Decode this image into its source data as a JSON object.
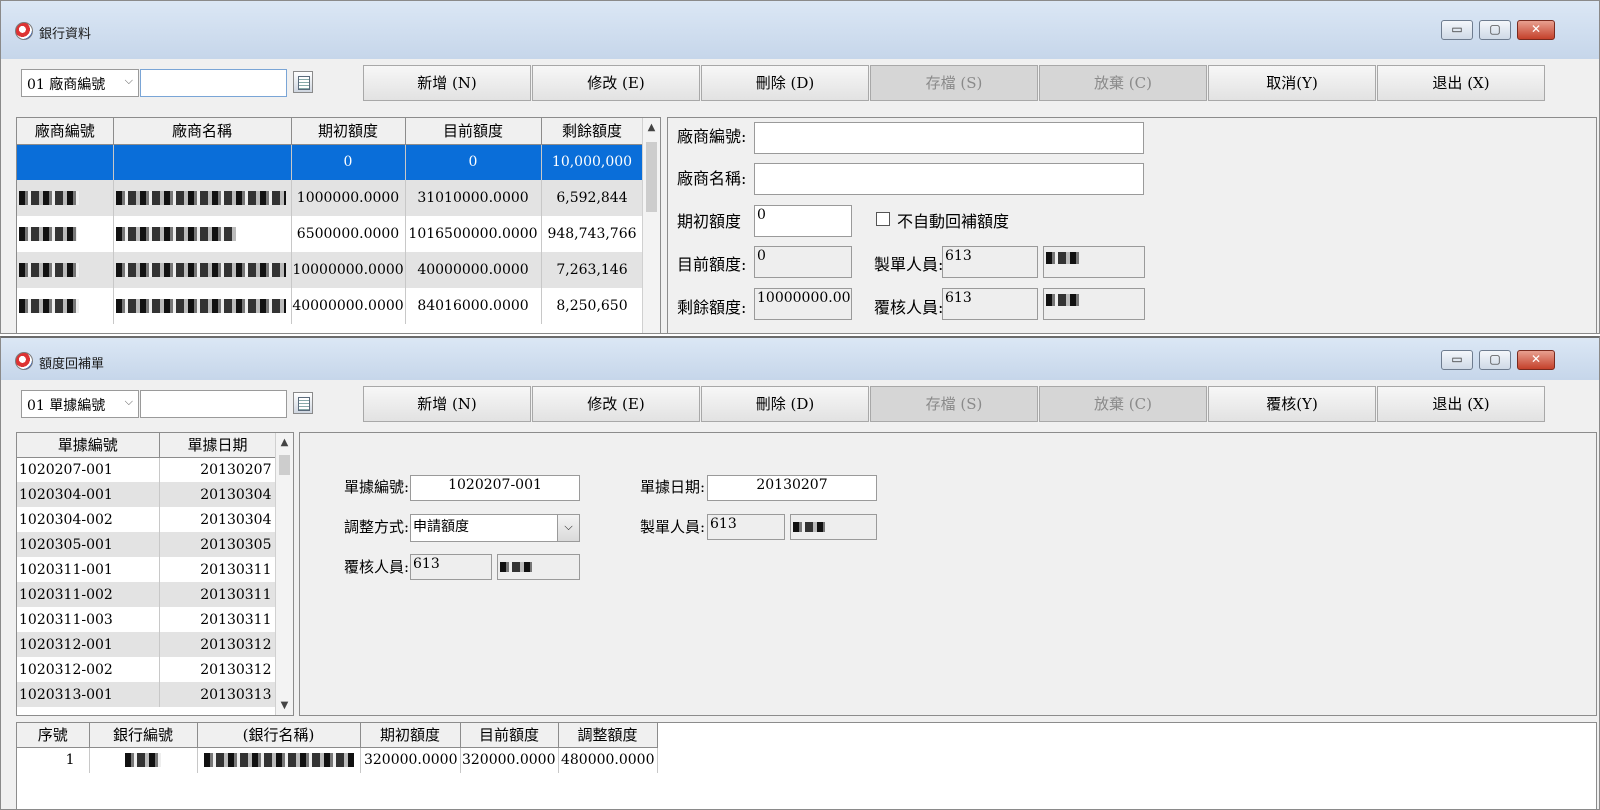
{
  "win1": {
    "title": "銀行資料",
    "controls": {
      "min": "▭",
      "max": "▢",
      "close": "✕"
    },
    "toolbar": {
      "search_select": "01 廠商編號",
      "buttons": [
        "新增 (N)",
        "修改 (E)",
        "刪除 (D)",
        "存檔 (S)",
        "放棄 (C)",
        "取消(Y)",
        "退出 (X)"
      ]
    },
    "grid": {
      "headers": [
        "廠商編號",
        "廠商名稱",
        "期初額度",
        "目前額度",
        "剩餘額度"
      ],
      "rows": [
        [
          "",
          "",
          "0",
          "0",
          "10,000,000"
        ],
        [
          "",
          "",
          "1000000.0000",
          "31010000.0000",
          "6,592,844"
        ],
        [
          "",
          "",
          "6500000.0000",
          "1016500000.0000",
          "948,743,766"
        ],
        [
          "",
          "",
          "10000000.0000",
          "40000000.0000",
          "7,263,146"
        ],
        [
          "",
          "",
          "40000000.0000",
          "84016000.0000",
          "8,250,650"
        ]
      ]
    },
    "form": {
      "vendor_no_label": "廠商編號:",
      "vendor_name_label": "廠商名稱:",
      "initial_label": "期初額度",
      "initial_value": "0",
      "no_auto_label": "不自動回補額度",
      "current_label": "目前額度:",
      "current_value": "0",
      "maker_label": "製單人員:",
      "maker_value": "613",
      "remain_label": "剩餘額度:",
      "remain_value": "10000000.00",
      "reviewer_label": "覆核人員:",
      "reviewer_value": "613"
    }
  },
  "win2": {
    "title": "額度回補單",
    "controls": {
      "min": "▭",
      "max": "▢",
      "close": "✕"
    },
    "toolbar": {
      "search_select": "01 單據編號",
      "buttons": [
        "新增 (N)",
        "修改 (E)",
        "刪除 (D)",
        "存檔 (S)",
        "放棄 (C)",
        "覆核(Y)",
        "退出 (X)"
      ]
    },
    "list": {
      "headers": [
        "單據編號",
        "單據日期"
      ],
      "rows": [
        [
          "1020207-001",
          "20130207"
        ],
        [
          "1020304-001",
          "20130304"
        ],
        [
          "1020304-002",
          "20130304"
        ],
        [
          "1020305-001",
          "20130305"
        ],
        [
          "1020311-001",
          "20130311"
        ],
        [
          "1020311-002",
          "20130311"
        ],
        [
          "1020311-003",
          "20130311"
        ],
        [
          "1020312-001",
          "20130312"
        ],
        [
          "1020312-002",
          "20130312"
        ],
        [
          "1020313-001",
          "20130313"
        ]
      ]
    },
    "form": {
      "doc_no_label": "單據編號:",
      "doc_no_value": "1020207-001",
      "doc_date_label": "單據日期:",
      "doc_date_value": "20130207",
      "adjust_label": "調整方式:",
      "adjust_value": "申請額度",
      "maker_label": "製單人員:",
      "maker_value": "613",
      "reviewer_label": "覆核人員:",
      "reviewer_value": "613"
    },
    "detail": {
      "headers": [
        "序號",
        "銀行編號",
        "(銀行名稱)",
        "期初額度",
        "目前額度",
        "調整額度"
      ],
      "rows": [
        [
          "1",
          "",
          "",
          "320000.0000",
          "320000.0000",
          "480000.0000"
        ]
      ]
    }
  }
}
